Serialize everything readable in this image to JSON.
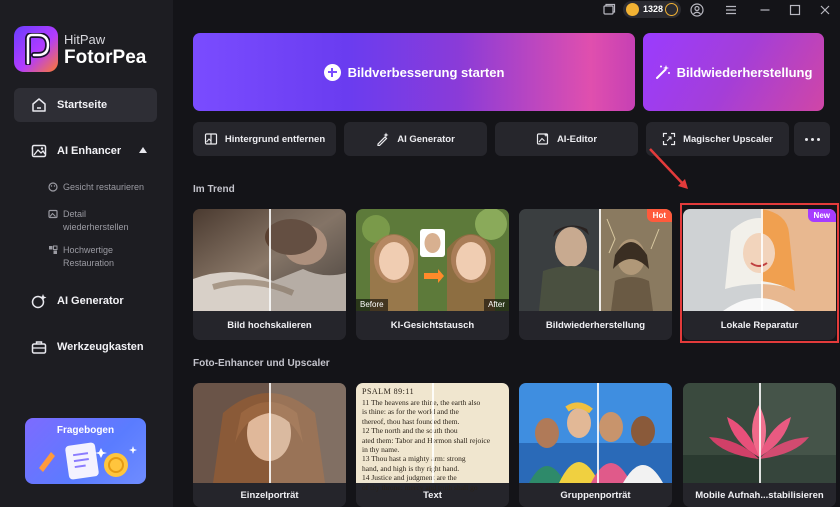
{
  "brand": {
    "line1": "HitPaw",
    "line2": "FotorPea"
  },
  "sidebar": {
    "items": [
      {
        "label": "Startseite"
      },
      {
        "label": "AI Enhancer"
      },
      {
        "label": "AI Generator"
      },
      {
        "label": "Werkzeugkasten"
      }
    ],
    "sub_items": [
      {
        "label": "Gesicht restaurieren"
      },
      {
        "label": "Detail wiederherstellen"
      },
      {
        "label": "Hochwertige Restauration"
      }
    ],
    "survey_label": "Fragebogen"
  },
  "titlebar": {
    "coin_count": "1328"
  },
  "hero": {
    "main_label": "Bildverbesserung starten",
    "side_label": "Bildwiederherstellung"
  },
  "tools": [
    {
      "label": "Hintergrund entfernen"
    },
    {
      "label": "AI Generator"
    },
    {
      "label": "AI-Editor"
    },
    {
      "label": "Magischer Upscaler"
    }
  ],
  "sections": {
    "trend_title": "Im Trend",
    "enhancer_title": "Foto-Enhancer und Upscaler"
  },
  "trend_cards": [
    {
      "label": "Bild hochskalieren"
    },
    {
      "label": "KI-Gesichtstausch",
      "before": "Before",
      "after": "After"
    },
    {
      "label": "Bildwiederherstellung",
      "tag": "Hot"
    },
    {
      "label": "Lokale Reparatur",
      "tag": "New"
    }
  ],
  "enhancer_cards": [
    {
      "label": "Einzelporträt"
    },
    {
      "label": "Text"
    },
    {
      "label": "Gruppenporträt"
    },
    {
      "label": "Mobile Aufnah...stabilisieren"
    }
  ],
  "psalm": {
    "heading": "PSALM 89:11",
    "lines": [
      "11 The heavens are thine, the earth also",
      "is thine: as for the world and the",
      "thereof, thou hast founded them.",
      "12 The north and the south thou",
      "ated them: Tabor and Hermon shall rejoice",
      "in thy name.",
      "13 Thou hast a mighty arm: strong",
      "hand, and high is thy right hand.",
      "14 Justice and judgment are the",
      "of thy throne: mercy and truth shall go",
      "before thy face."
    ]
  },
  "colors": {
    "accent_purple": "#7a4cff",
    "hot_tag": "#ff5a3c",
    "new_tag": "#a63cff",
    "highlight_red": "#e33b3b",
    "coin": "#f2b233"
  }
}
